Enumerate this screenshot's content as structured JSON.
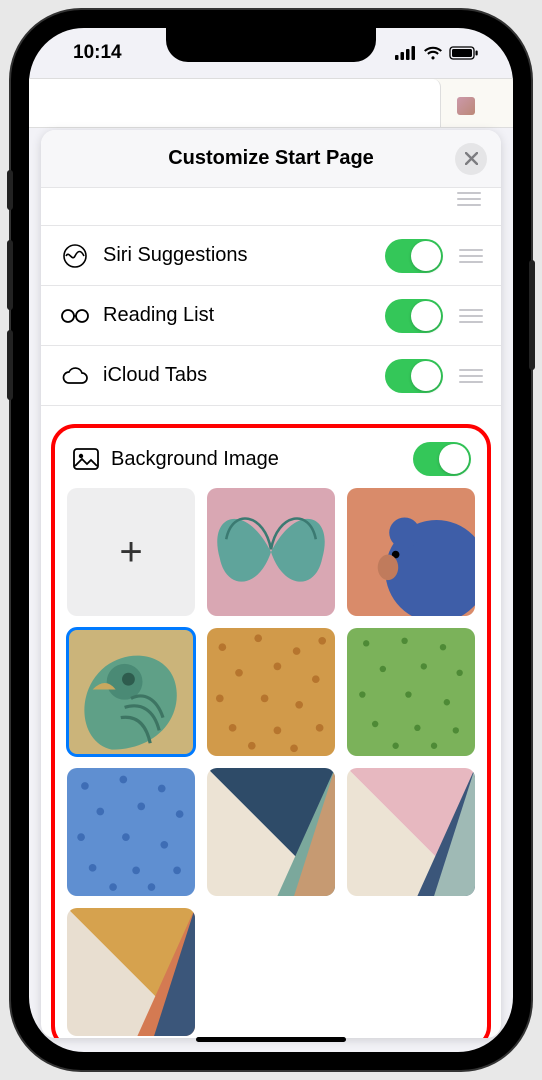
{
  "statusbar": {
    "time": "10:14"
  },
  "panel": {
    "title": "Customize Start Page"
  },
  "options": [
    {
      "label": "Siri Suggestions",
      "enabled": true,
      "icon": "siri"
    },
    {
      "label": "Reading List",
      "enabled": true,
      "icon": "glasses"
    },
    {
      "label": "iCloud Tabs",
      "enabled": true,
      "icon": "cloud"
    }
  ],
  "background": {
    "label": "Background Image",
    "enabled": true,
    "thumbs": [
      {
        "kind": "add"
      },
      {
        "kind": "butterfly"
      },
      {
        "kind": "bear"
      },
      {
        "kind": "parrot",
        "selected": true
      },
      {
        "kind": "dots-orange"
      },
      {
        "kind": "dots-green"
      },
      {
        "kind": "dots-blue"
      },
      {
        "kind": "rays-dark"
      },
      {
        "kind": "rays-pink"
      },
      {
        "kind": "rays-gold"
      }
    ]
  }
}
